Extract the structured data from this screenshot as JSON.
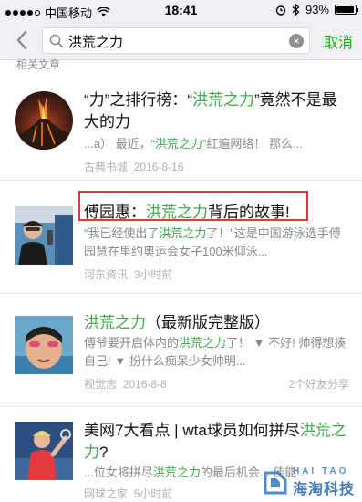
{
  "status": {
    "carrier": "中国移动",
    "time": "18:41",
    "battery": "93%",
    "signal_bars": 4,
    "battery_level": 0.93
  },
  "search": {
    "query": "洪荒之力",
    "cancel_label": "取消"
  },
  "section_label": "相关文章",
  "results": [
    {
      "title_pre": "“力”之排行榜：“",
      "title_hl": "洪荒之力",
      "title_post": "”竟然不是最大的力",
      "snippet_pre": "...a）  最近，“",
      "snippet_hl": "洪荒之力",
      "snippet_post": "”红遍网络！ 那么...",
      "source": "古典书城",
      "date": "2016-8-16",
      "thumb": "volcano-thumbnail"
    },
    {
      "title_pre": "傅园惠：",
      "title_hl": "洪荒之力",
      "title_post": "背后的故事!",
      "snippet_pre": "“我已经使出了",
      "snippet_hl": "洪荒之力",
      "snippet_post": "了！”这是中国游泳选手傅园慧在里约奥运会女子100米仰泳...",
      "source": "河东资讯",
      "date": "3小时前",
      "thumb": "swimmer-interview-thumbnail"
    },
    {
      "title_pre": "",
      "title_hl": "洪荒之力",
      "title_post": "（最新版完整版）",
      "snippet_pre": "傅爷要开启体内的",
      "snippet_hl": "洪荒之力",
      "snippet_post": "了！ ▼ 不好! 帅得想揍自己! ▼ 扮什么痴呆少女帅明...",
      "source": "视觉志",
      "date": "2016-8-8",
      "share": "2个好友分享",
      "thumb": "swimmer-goggles-thumbnail"
    },
    {
      "title_pre": "美网7大看点 | wta球员如何拼尽",
      "title_hl": "洪荒之力",
      "title_post": "?",
      "snippet_pre": "...位女将拼尽",
      "snippet_hl": "洪荒之力",
      "snippet_post": "的最后机会... 佳能...",
      "source": "网球之家",
      "date": "5小时前",
      "thumb": "tennis-player-thumbnail"
    }
  ],
  "watermark": {
    "en": "HAI TAO",
    "cn": "海淘科技"
  },
  "colors": {
    "highlight": "#42a84c",
    "cancel": "#1aad19",
    "redbox": "#d9363e"
  }
}
